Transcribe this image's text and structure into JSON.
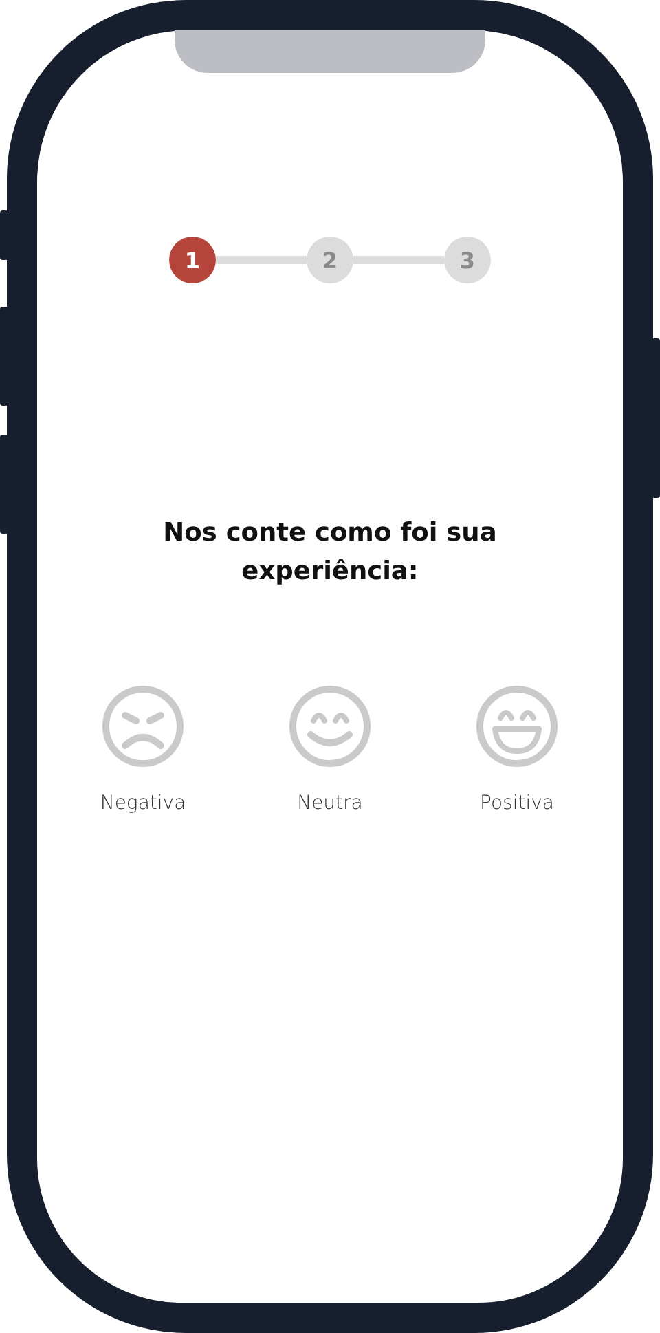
{
  "steps": [
    {
      "label": "1",
      "selected": true
    },
    {
      "label": "2",
      "selected": false
    },
    {
      "label": "3",
      "selected": false
    }
  ],
  "title": "Nos conte como foi sua experiência:",
  "options": [
    {
      "kind": "negative",
      "label": "Negativa"
    },
    {
      "kind": "neutral",
      "label": "Neutra"
    },
    {
      "kind": "positive",
      "label": "Positiva"
    }
  ]
}
